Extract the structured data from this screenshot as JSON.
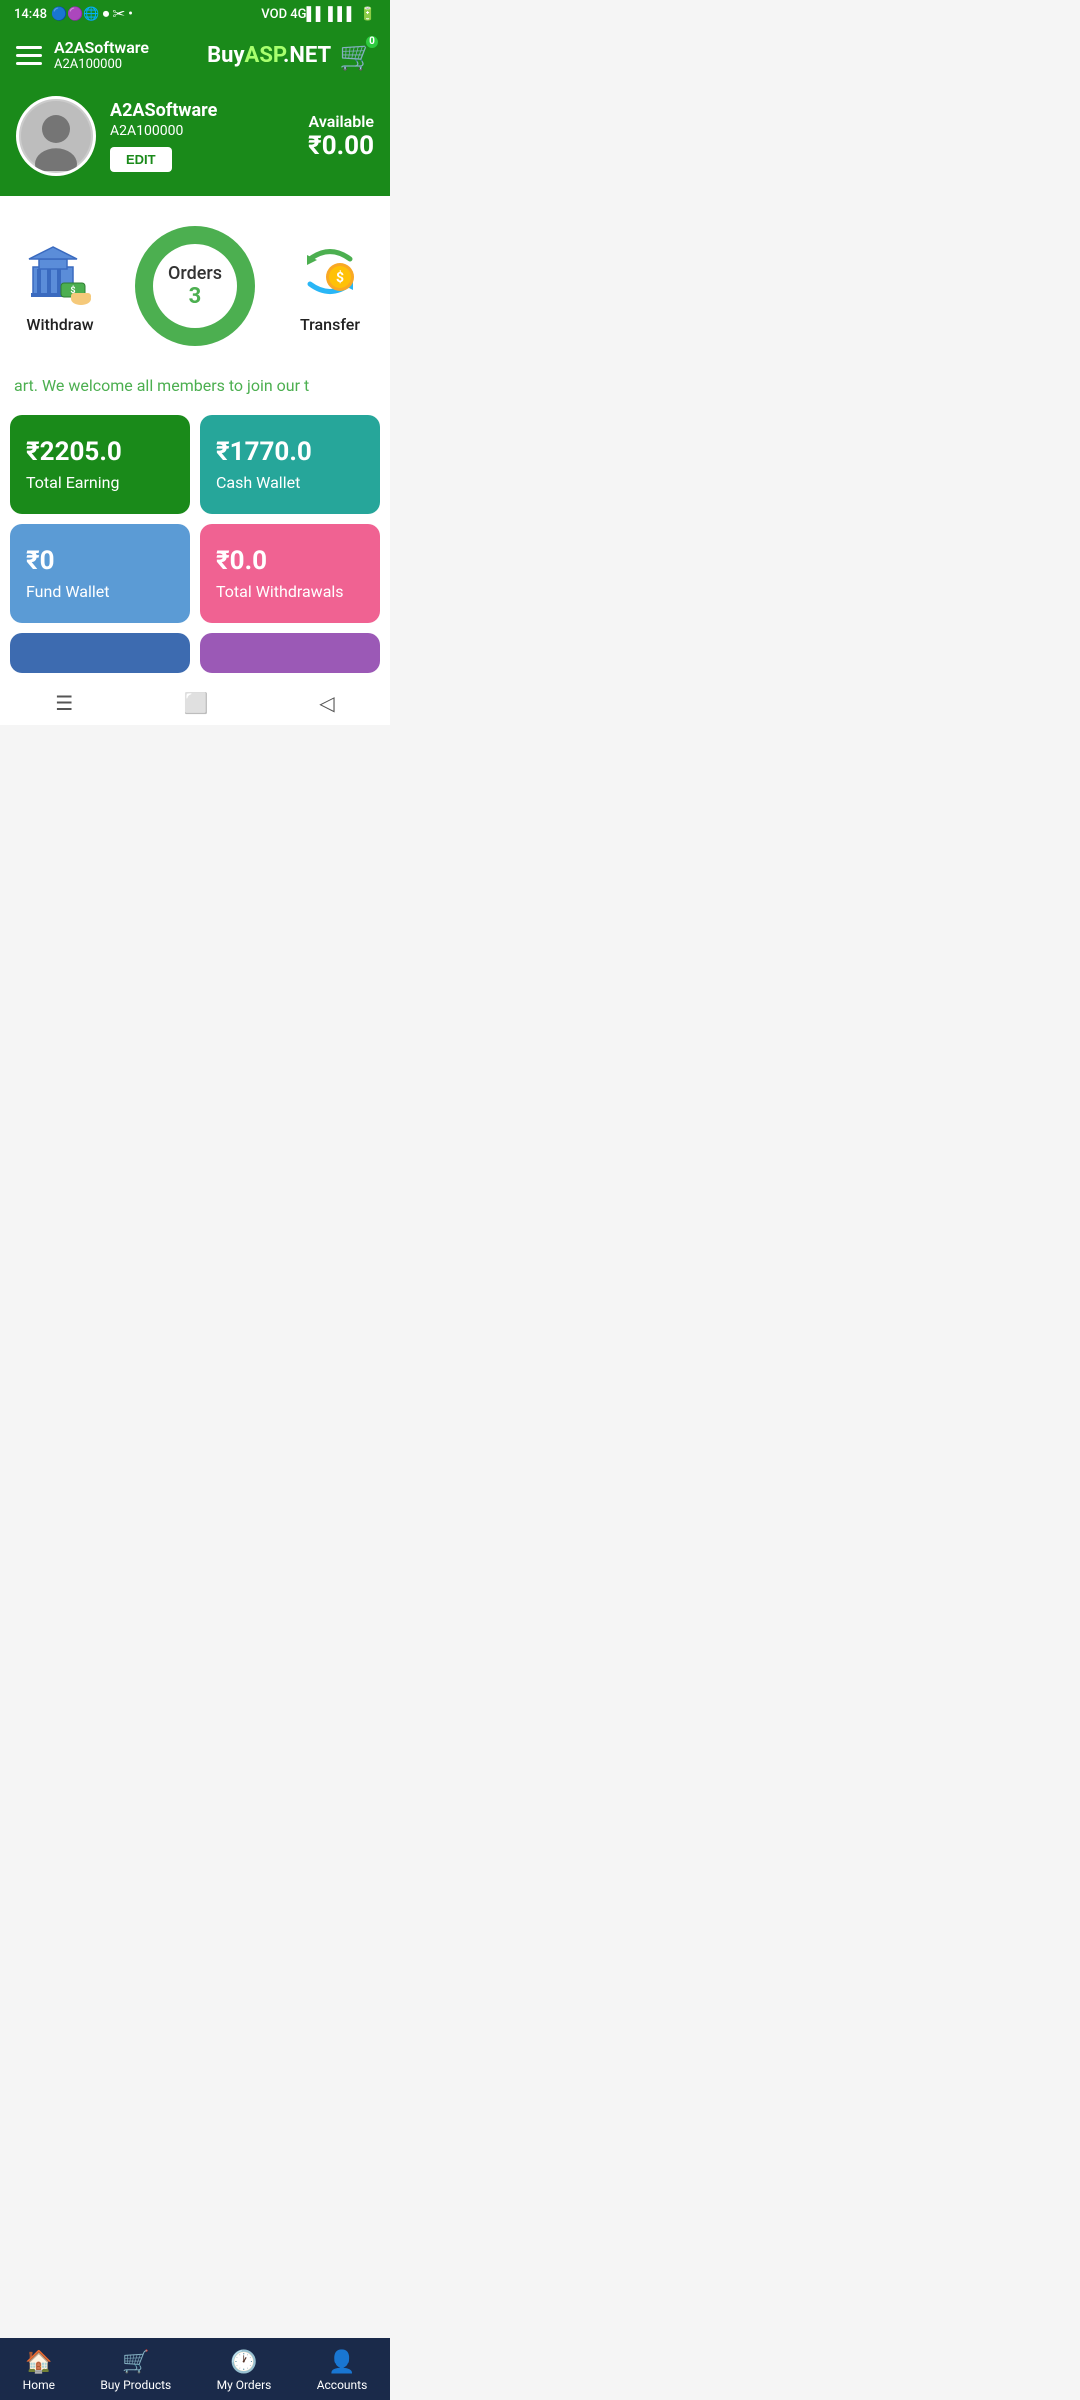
{
  "statusBar": {
    "time": "14:48",
    "batteryIcon": "🔋"
  },
  "header": {
    "userName": "A2ASoftware",
    "userId": "A2A100000",
    "brandBuy": "Buy",
    "brandAsp": "ASP",
    "brandNet": ".NET",
    "cartCount": "0"
  },
  "profile": {
    "name": "A2ASoftware",
    "id": "A2A100000",
    "editLabel": "EDIT",
    "availableLabel": "Available",
    "balance": "₹0.00"
  },
  "orders": {
    "label": "Orders",
    "count": "3"
  },
  "actions": {
    "withdrawLabel": "Withdraw",
    "transferLabel": "Transfer"
  },
  "welcomeText": "art. We welcome all members to join our t",
  "stats": [
    {
      "amount": "₹2205.0",
      "label": "Total Earning",
      "color": "card-green"
    },
    {
      "amount": "₹1770.0",
      "label": "Cash Wallet",
      "color": "card-teal"
    },
    {
      "amount": "₹0",
      "label": "Fund Wallet",
      "color": "card-blue"
    },
    {
      "amount": "₹0.0",
      "label": "Total Withdrawals",
      "color": "card-pink"
    }
  ],
  "bottomNav": [
    {
      "icon": "🏠",
      "label": "Home",
      "name": "nav-home"
    },
    {
      "icon": "🛒",
      "label": "Buy Products",
      "name": "nav-buy-products"
    },
    {
      "icon": "🕐",
      "label": "My Orders",
      "name": "nav-my-orders"
    },
    {
      "icon": "👤",
      "label": "Accounts",
      "name": "nav-accounts"
    }
  ],
  "sysNav": {
    "menuIcon": "☰",
    "homeIcon": "⬜",
    "backIcon": "◁"
  }
}
